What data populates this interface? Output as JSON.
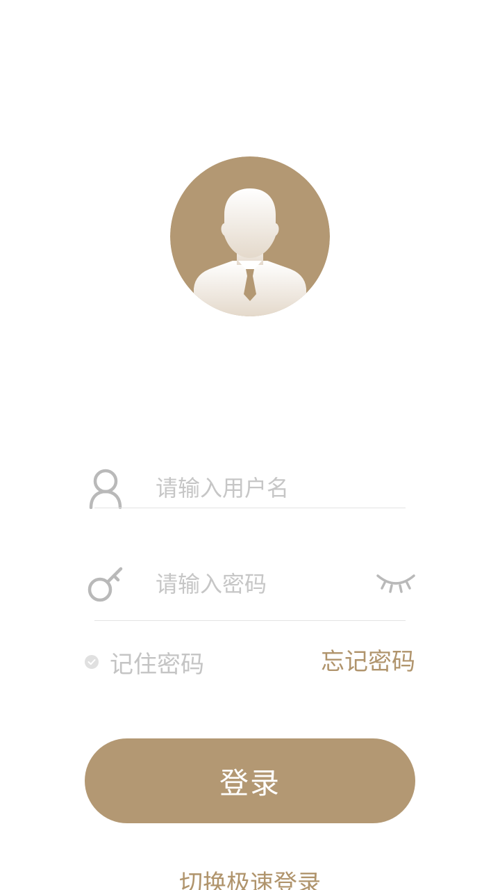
{
  "avatar": {
    "icon": "user-avatar-icon",
    "background_color": "#b39873"
  },
  "username": {
    "icon": "user-icon",
    "placeholder": "请输入用户名"
  },
  "password": {
    "icon": "key-icon",
    "placeholder": "请输入密码",
    "visibility_icon": "eye-closed-icon"
  },
  "remember": {
    "label": "记住密码",
    "checked": false
  },
  "forgot_label": "忘记密码",
  "login_label": "登录",
  "switch_label": "切换极速登录",
  "colors": {
    "accent": "#b39873",
    "placeholder": "#c6c6c6",
    "divider": "#e3e3e3"
  }
}
